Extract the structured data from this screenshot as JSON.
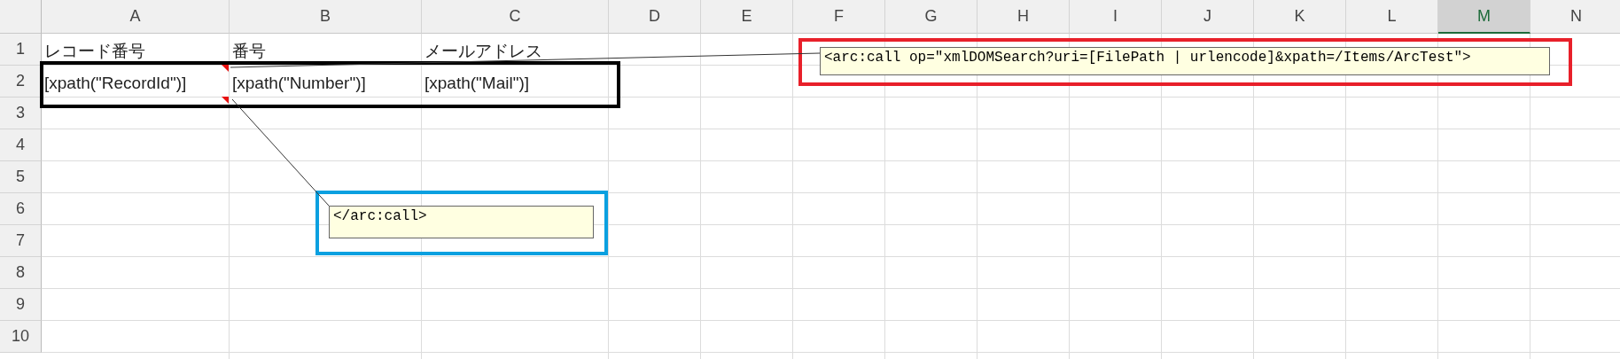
{
  "columns": [
    {
      "label": "A",
      "selected": false
    },
    {
      "label": "B",
      "selected": false
    },
    {
      "label": "C",
      "selected": false
    },
    {
      "label": "D",
      "selected": false
    },
    {
      "label": "E",
      "selected": false
    },
    {
      "label": "F",
      "selected": false
    },
    {
      "label": "G",
      "selected": false
    },
    {
      "label": "H",
      "selected": false
    },
    {
      "label": "I",
      "selected": false
    },
    {
      "label": "J",
      "selected": false
    },
    {
      "label": "K",
      "selected": false
    },
    {
      "label": "L",
      "selected": false
    },
    {
      "label": "M",
      "selected": true
    },
    {
      "label": "N",
      "selected": false
    }
  ],
  "rows": [
    {
      "number": "1",
      "cells": [
        "レコード番号",
        "番号",
        "メールアドレス"
      ]
    },
    {
      "number": "2",
      "cells": [
        "[xpath(\"RecordId\")]",
        "[xpath(\"Number\")]",
        "[xpath(\"Mail\")]"
      ]
    },
    {
      "number": "3",
      "cells": []
    },
    {
      "number": "4",
      "cells": []
    },
    {
      "number": "5",
      "cells": []
    },
    {
      "number": "6",
      "cells": []
    },
    {
      "number": "7",
      "cells": []
    },
    {
      "number": "8",
      "cells": []
    },
    {
      "number": "9",
      "cells": []
    },
    {
      "number": "10",
      "cells": []
    }
  ],
  "comments": [
    {
      "text": "<arc:call op=\"xmlDOMSearch?uri=[FilePath | urlencode]&xpath=/Items/ArcTest\">"
    },
    {
      "text": "</arc:call>"
    }
  ],
  "annotations": [
    {
      "color": "#e8202a"
    },
    {
      "color": "#0aa0e0"
    },
    {
      "color": "#000000"
    }
  ]
}
